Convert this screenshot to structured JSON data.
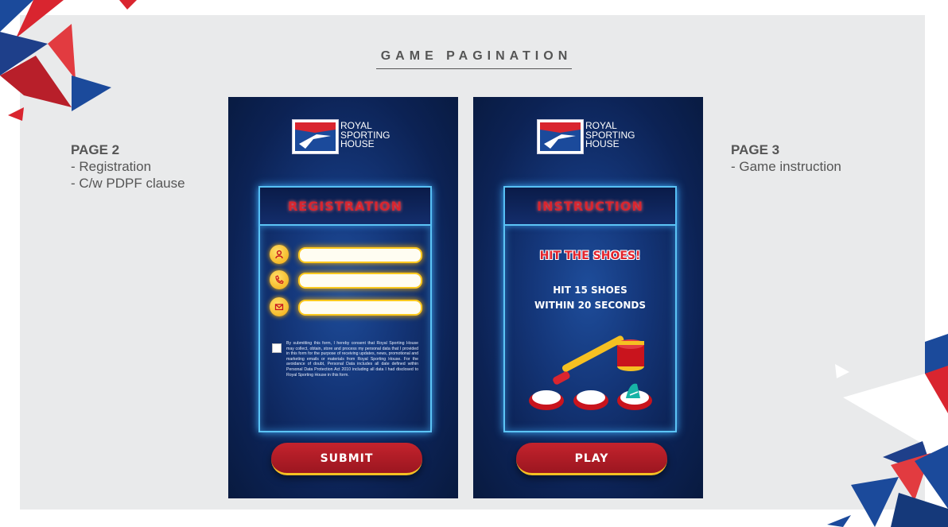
{
  "heading": "GAME PAGINATION",
  "left_note": {
    "title": "PAGE 2",
    "line1": "- Registration",
    "line2": "- C/w PDPF clause"
  },
  "right_note": {
    "title": "PAGE 3",
    "line1": "- Game instruction"
  },
  "brand": {
    "line1": "ROYAL",
    "line2": "SPORTING",
    "line3": "HOUSE"
  },
  "registration_screen": {
    "title": "REGISTRATION",
    "fields": [
      {
        "icon": "user-icon",
        "value": ""
      },
      {
        "icon": "phone-icon",
        "value": ""
      },
      {
        "icon": "mail-icon",
        "value": ""
      }
    ],
    "consent": "By submitting this form, I hereby consent that Royal Sporting House may collect, obtain, store and process my personal data that I provided in this form for the purpose of receiving updates, news, promotional and marketing emails or materials from Royal Sporting House. For the avoidance of doubt, Personal Data includes all date defined within Personal Data Protection Act 2010 including all data I had disclosed to Royal Sporting House in this form.",
    "submit": "SUBMIT"
  },
  "instruction_screen": {
    "title": "INSTRUCTION",
    "headline": "HIT THE SHOES!",
    "line1": "HIT 15 SHOES",
    "line2": "WITHIN 20 SECONDS",
    "play": "PLAY"
  },
  "colors": {
    "panel": "#e9eaeb",
    "brand_red": "#d9252f",
    "brand_blue": "#1b4a9b",
    "neon": "#5cc4f5",
    "gold": "#ffc91f"
  }
}
